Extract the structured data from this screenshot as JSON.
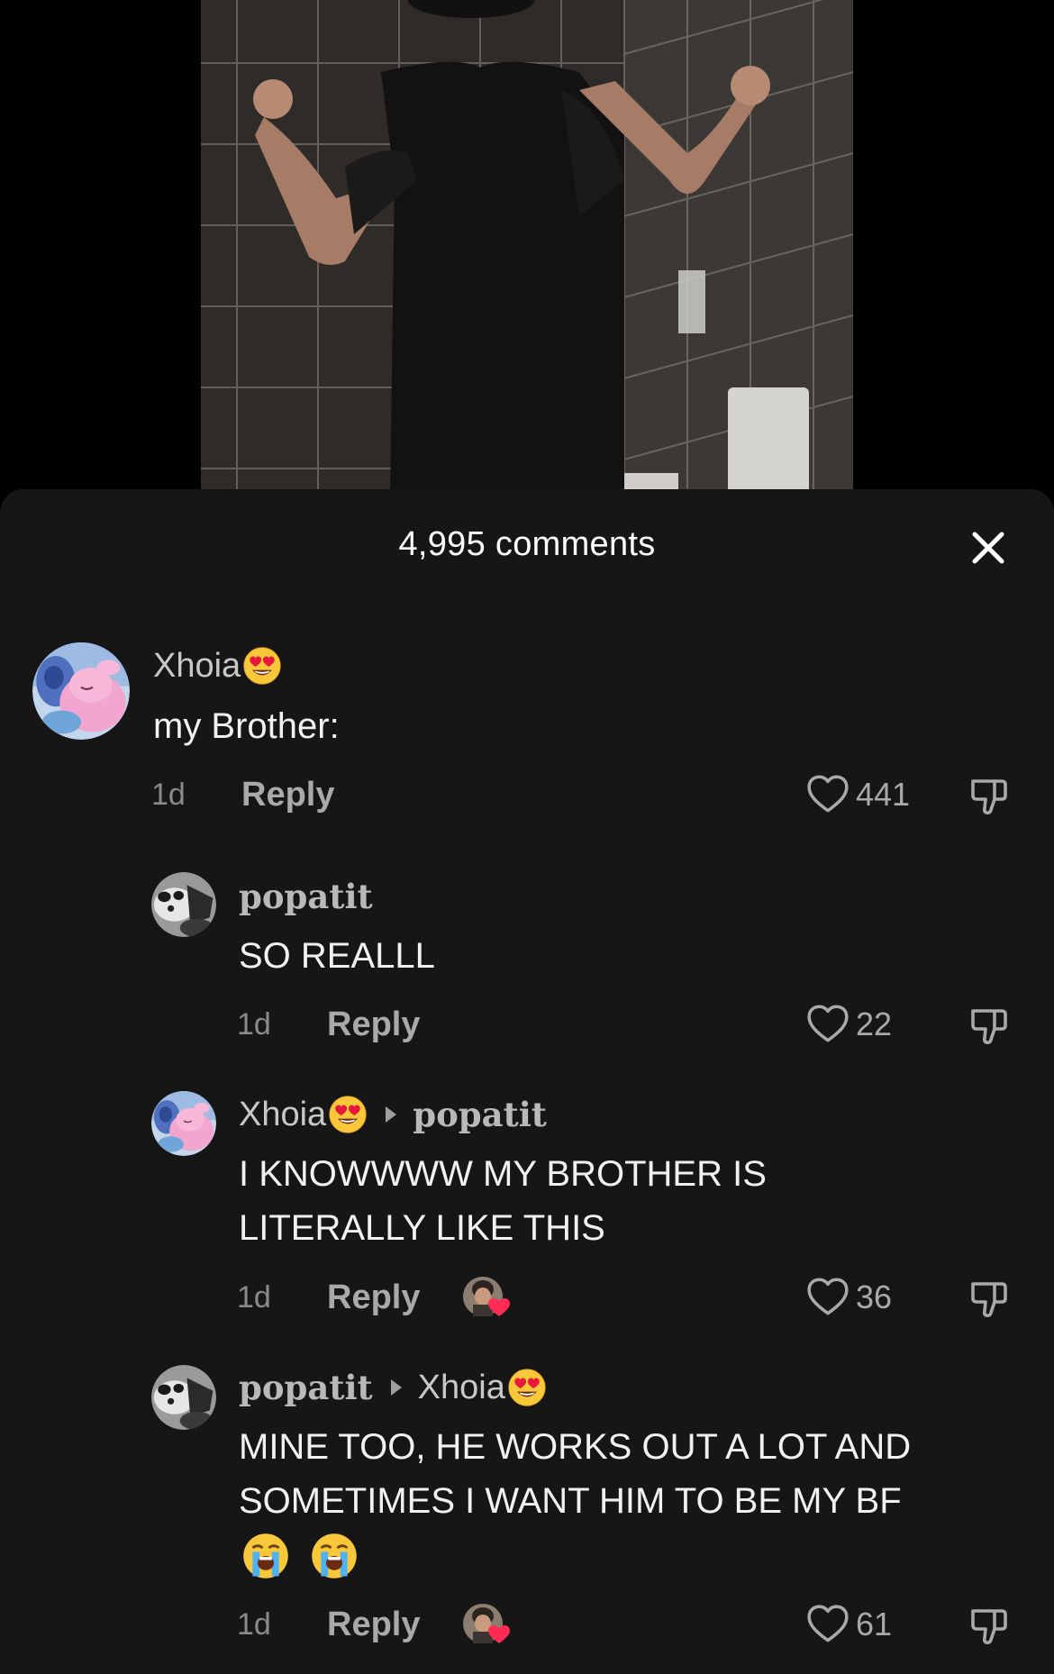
{
  "comments_header": {
    "count_label": "4,995 comments"
  },
  "icons": {
    "close": "close-icon",
    "like": "heart-outline-icon",
    "dislike": "thumbs-down-icon",
    "heart_eyes": "heart-eyes-emoji",
    "crying": "loudly-crying-emoji",
    "reply_to": "triangle-right-icon"
  },
  "colors": {
    "sheet_bg": "#161616",
    "text_primary": "#f1f1f1",
    "text_secondary": "#a9a9a9",
    "creator_heart": "#fe2c55"
  },
  "comments": [
    {
      "username": "Xhoia",
      "text": "my Brother:",
      "time": "1d",
      "reply_label": "Reply",
      "likes": "441"
    },
    {
      "username": "popatit",
      "text": "SO REALLL",
      "time": "1d",
      "reply_label": "Reply",
      "likes": "22"
    },
    {
      "username": "Xhoia",
      "reply_to": "popatit",
      "text_line1": "I KNOWWWW MY BROTHER IS",
      "text_line2": "LITERALLY LIKE THIS",
      "time": "1d",
      "reply_label": "Reply",
      "likes": "36"
    },
    {
      "username": "popatit",
      "reply_to": "Xhoia",
      "text_line1": "MINE TOO, HE WORKS OUT A LOT AND",
      "text_line2": "SOMETIMES I WANT HIM TO BE MY BF",
      "time": "1d",
      "reply_label": "Reply",
      "likes": "61"
    }
  ]
}
